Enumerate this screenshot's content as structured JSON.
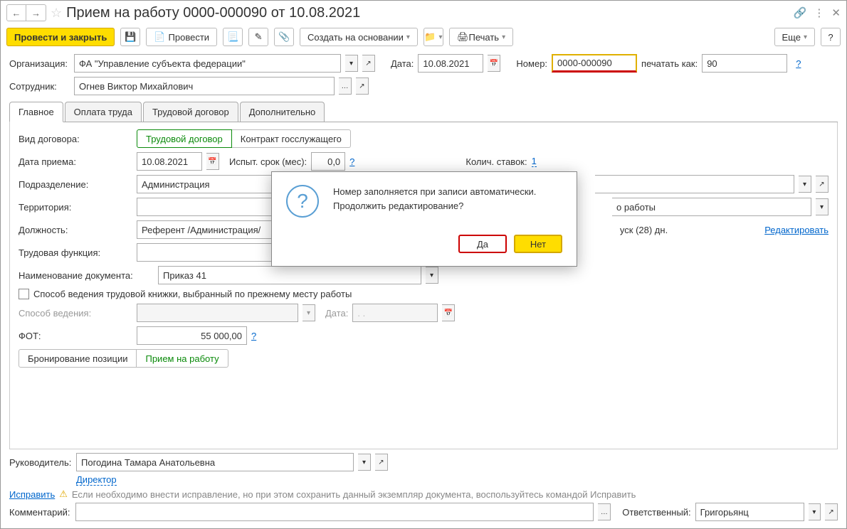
{
  "title": "Прием на работу 0000-000090 от 10.08.2021",
  "toolbar": {
    "post_close": "Провести и закрыть",
    "post": "Провести",
    "create_based": "Создать на основании",
    "print": "Печать",
    "more": "Еще",
    "help": "?"
  },
  "header": {
    "org_label": "Организация:",
    "org_value": "ФА \"Управление субъекта федерации\"",
    "date_label": "Дата:",
    "date_value": "10.08.2021",
    "num_label": "Номер:",
    "num_value": "0000-000090",
    "print_as_label": "печатать как:",
    "print_as_value": "90",
    "emp_label": "Сотрудник:",
    "emp_value": "Огнев Виктор Михайлович"
  },
  "tabs": [
    "Главное",
    "Оплата труда",
    "Трудовой договор",
    "Дополнительно"
  ],
  "main": {
    "contract_type_label": "Вид договора:",
    "contract_type_a": "Трудовой договор",
    "contract_type_b": "Контракт госслужащего",
    "hire_date_label": "Дата приема:",
    "hire_date": "10.08.2021",
    "probation_label": "Испыт. срок (мес):",
    "probation": "0,0",
    "rate_label": "Колич. ставок:",
    "rate": "1",
    "dept_label": "Подразделение:",
    "dept": "Администрация",
    "territory_label": "Территория:",
    "work_right": "о работы",
    "position_label": "Должность:",
    "position": "Референт /Администрация/",
    "vac_right": "уск (28) дн.",
    "edit_link": "Редактировать",
    "func_label": "Трудовая функция:",
    "doc_name_label": "Наименование документа:",
    "doc_name": "Приказ 41",
    "cb_label": "Способ ведения трудовой книжки, выбранный по прежнему месту работы",
    "method_label": "Способ ведения:",
    "method_date_label": "Дата:",
    "method_date_placeholder": ".  .",
    "fot_label": "ФОТ:",
    "fot": "55 000,00",
    "booking": "Бронирование позиции",
    "hire": "Прием на работу"
  },
  "footer": {
    "head_label": "Руководитель:",
    "head_value": "Погодина Тамара Анатольевна",
    "head_role": "Директор",
    "fix_link": "Исправить",
    "fix_note": "Если необходимо внести исправление, но при этом сохранить данный экземпляр документа, воспользуйтесь командой Исправить",
    "comment_label": "Комментарий:",
    "resp_label": "Ответственный:",
    "resp_value": "Григорьянц"
  },
  "dialog": {
    "line1": "Номер заполняется при записи автоматически.",
    "line2": "Продолжить редактирование?",
    "yes": "Да",
    "no": "Нет"
  }
}
